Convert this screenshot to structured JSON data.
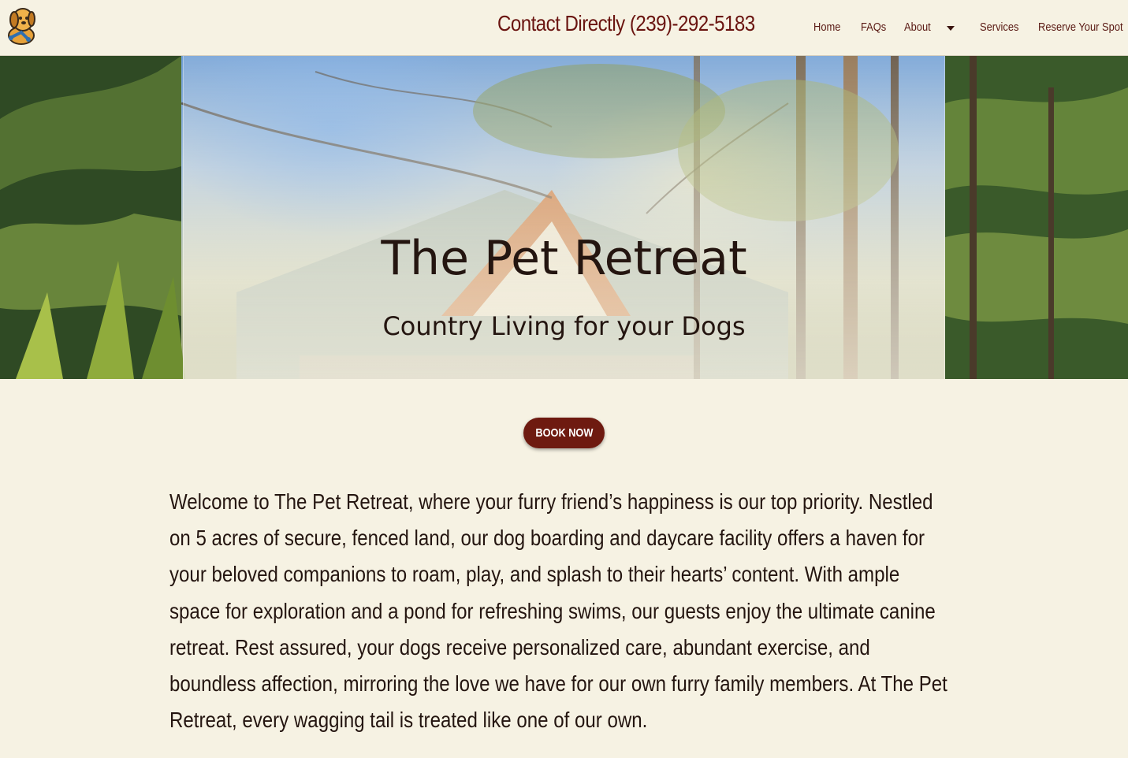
{
  "header": {
    "logo_icon": "dog-mascot-icon",
    "contact_text": "Contact Directly (239)-292-5183",
    "nav": {
      "home": "Home",
      "faqs": "FAQs",
      "about": "About",
      "services": "Services",
      "reserve": "Reserve Your Spot"
    }
  },
  "hero": {
    "title": "The Pet Retreat",
    "subtitle": "Country Living for your Dogs"
  },
  "cta": {
    "book_label": "BOOK NOW"
  },
  "welcome": {
    "text": "Welcome to The Pet Retreat, where your furry friend’s happiness is our top priority. Nestled on 5 acres of secure, fenced land, our dog boarding and daycare facility offers a haven for your beloved companions to roam, play, and splash to their hearts’ content. With ample space for exploration and a pond for refreshing swims, our guests enjoy the ultimate canine retreat. Rest assured, your dogs receive personalized care, abundant exercise, and boundless affection, mirroring the love we have for our own furry family members. At The Pet Retreat, every wagging tail is treated like one of our own."
  },
  "colors": {
    "page_background": "#f6f2e3",
    "brand_maroon": "#6e1a10",
    "text_dark": "#241510"
  }
}
